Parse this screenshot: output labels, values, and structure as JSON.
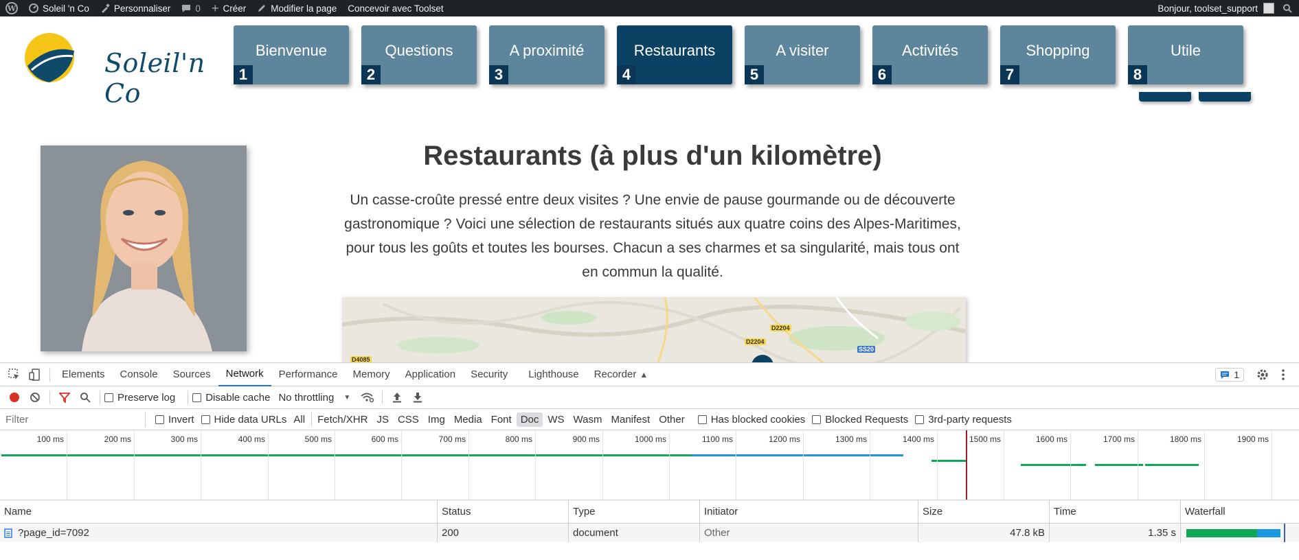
{
  "adminbar": {
    "site_name": "Soleil 'n Co",
    "customize": "Personnaliser",
    "comments_count": "0",
    "create": "Créer",
    "edit_page": "Modifier la page",
    "toolset": "Concevoir avec Toolset",
    "greeting": "Bonjour, toolset_support"
  },
  "header": {
    "logo_text": "Soleil'n Co",
    "nav": [
      {
        "label": "Bienvenue",
        "num": "1"
      },
      {
        "label": "Questions",
        "num": "2"
      },
      {
        "label": "A proximité",
        "num": "3"
      },
      {
        "label": "Restaurants",
        "num": "4"
      },
      {
        "label": "A visiter",
        "num": "5"
      },
      {
        "label": "Activités",
        "num": "6"
      },
      {
        "label": "Shopping",
        "num": "7"
      },
      {
        "label": "Utile",
        "num": "8"
      }
    ]
  },
  "main": {
    "title": "Restaurants (à plus d'un kilomètre)",
    "intro": "Un casse-croûte pressé entre deux visites ? Une envie de pause gourmande ou de découverte gastronomique ? Voici une sélection de restaurants situés aux quatre coins des Alpes-Maritimes, pour tous les goûts et toutes les bourses. Chacun a ses charmes et sa singularité, mais tous ont en commun la qualité.",
    "map_labels": [
      "D2204",
      "D2204",
      "D4085",
      "SS20"
    ]
  },
  "devtools": {
    "tabs": [
      "Elements",
      "Console",
      "Sources",
      "Network",
      "Performance",
      "Memory",
      "Application",
      "Security",
      "Lighthouse",
      "Recorder"
    ],
    "active_tab": "Network",
    "issues_count": "1",
    "toolbar": {
      "preserve_log": "Preserve log",
      "disable_cache": "Disable cache",
      "throttling": "No throttling"
    },
    "filter": {
      "placeholder": "Filter",
      "invert": "Invert",
      "hide_data_urls": "Hide data URLs",
      "types": [
        "All",
        "Fetch/XHR",
        "JS",
        "CSS",
        "Img",
        "Media",
        "Font",
        "Doc",
        "WS",
        "Wasm",
        "Manifest",
        "Other"
      ],
      "selected_type": "Doc",
      "has_blocked_cookies": "Has blocked cookies",
      "blocked_requests": "Blocked Requests",
      "third_party": "3rd-party requests"
    },
    "timeline_ticks": [
      "100 ms",
      "200 ms",
      "300 ms",
      "400 ms",
      "500 ms",
      "600 ms",
      "700 ms",
      "800 ms",
      "900 ms",
      "1000 ms",
      "1100 ms",
      "1200 ms",
      "1300 ms",
      "1400 ms",
      "1500 ms",
      "1600 ms",
      "1700 ms",
      "1800 ms",
      "1900 ms"
    ],
    "columns": [
      "Name",
      "Status",
      "Type",
      "Initiator",
      "Size",
      "Time",
      "Waterfall"
    ],
    "rows": [
      {
        "name": "?page_id=7092",
        "status": "200",
        "type": "document",
        "initiator": "Other",
        "size": "47.8 kB",
        "time": "1.35 s"
      }
    ]
  },
  "colors": {
    "nav_bg": "#5d869c",
    "nav_active": "#0b4263",
    "adminbar_bg": "#1d2327",
    "accent_blue": "#1a73e8",
    "waterfall_green": "#0fa656",
    "waterfall_blue": "#1a95e0"
  }
}
